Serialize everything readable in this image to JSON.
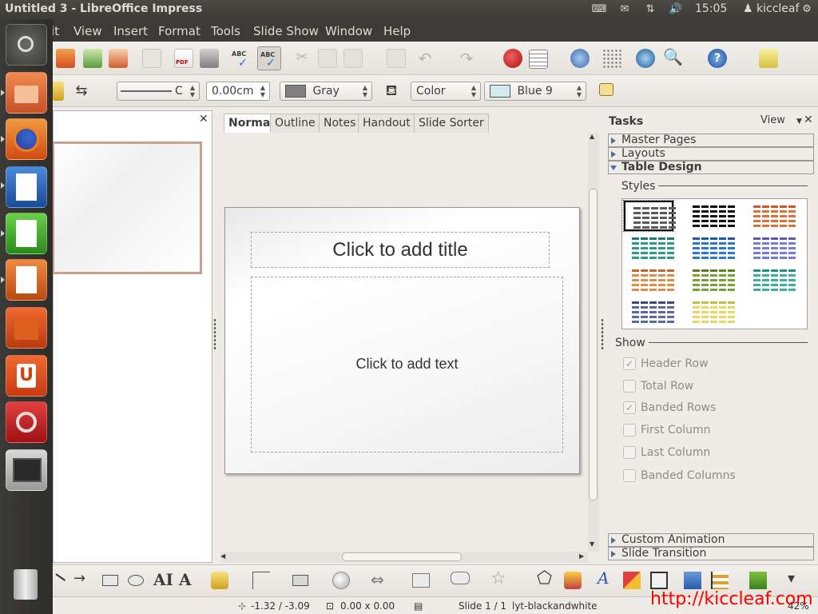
{
  "top_panel": {
    "window_title": "Untitled 3 - LibreOffice Impress",
    "clock": "15:05",
    "user": "kiccleaf"
  },
  "launcher": {
    "items": [
      "dash-home",
      "files",
      "firefox",
      "writer",
      "calc",
      "impress",
      "software-center",
      "ubuntu-one",
      "system-settings",
      "workspace-switcher"
    ],
    "trash": "trash"
  },
  "menubar": {
    "items": [
      "Edit",
      "View",
      "Insert",
      "Format",
      "Tools",
      "Slide Show",
      "Window",
      "Help"
    ],
    "edit_visible": "it"
  },
  "toolbar2": {
    "line_width_value": "0.00cm",
    "line_style_value": "C",
    "line_color_value": "Gray",
    "area_style_value": "Color",
    "area_color_value": "Blue 9"
  },
  "view_tabs": [
    "Normal",
    "Outline",
    "Notes",
    "Handout",
    "Slide Sorter"
  ],
  "slide": {
    "title_placeholder": "Click to add title",
    "text_placeholder": "Click to add text"
  },
  "tasks": {
    "title": "Tasks",
    "view_label": "View",
    "sections": [
      "Master Pages",
      "Layouts",
      "Table Design"
    ],
    "bottom_sections": [
      "Custom Animation",
      "Slide Transition"
    ],
    "styles_label": "Styles",
    "show_label": "Show",
    "show_options": [
      {
        "label": "Header Row",
        "checked": "✓"
      },
      {
        "label": "Total Row",
        "checked": ""
      },
      {
        "label": "Banded Rows",
        "checked": "✓"
      },
      {
        "label": "First Column",
        "checked": ""
      },
      {
        "label": "Last Column",
        "checked": ""
      },
      {
        "label": "Banded Columns",
        "checked": ""
      }
    ],
    "table_styles": [
      {
        "color": "#5a5a5a",
        "header": "#5a5a5a"
      },
      {
        "color": "#111111",
        "header": "#000000"
      },
      {
        "color": "#e0703a",
        "header": "#d4542a"
      },
      {
        "color": "#2a9a8a",
        "header": "#1d7a6e"
      },
      {
        "color": "#2a7acc",
        "header": "#1a5aaa"
      },
      {
        "color": "#7a7ad0",
        "header": "#5a5ab8"
      },
      {
        "color": "#d8904a",
        "header": "#b86a2a"
      },
      {
        "color": "#7aa03a",
        "header": "#5a8020"
      },
      {
        "color": "#3ab0a0",
        "header": "#209080"
      },
      {
        "color": "#5a6aa0",
        "header": "#3a4a80"
      },
      {
        "color": "#e8d860",
        "header": "#c8b840"
      }
    ]
  },
  "statusbar": {
    "position": "-1.32 / -3.09",
    "size": "0.00 x 0.00",
    "slide": "Slide 1 / 1",
    "layout": "lyt-blackandwhite",
    "zoom": "42%"
  },
  "watermark": "http://kiccleaf.com"
}
